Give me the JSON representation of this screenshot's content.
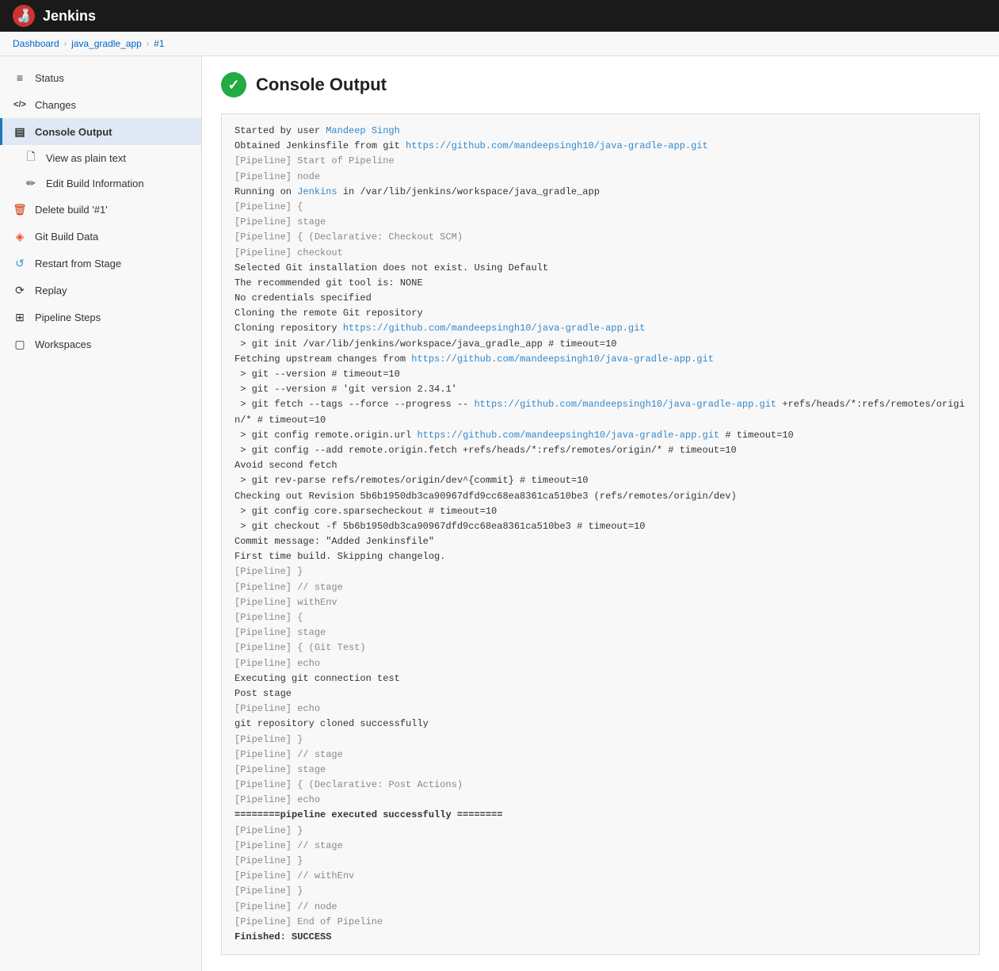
{
  "header": {
    "title": "Jenkins",
    "logo": "🍶"
  },
  "breadcrumb": {
    "items": [
      {
        "label": "Dashboard",
        "href": "#"
      },
      {
        "label": "java_gradle_app",
        "href": "#"
      },
      {
        "label": "#1",
        "href": "#"
      }
    ]
  },
  "sidebar": {
    "items": [
      {
        "id": "status",
        "label": "Status",
        "icon": "≡",
        "active": false
      },
      {
        "id": "changes",
        "label": "Changes",
        "icon": "</>",
        "active": false
      },
      {
        "id": "console-output",
        "label": "Console Output",
        "icon": "▤",
        "active": true
      },
      {
        "id": "view-plain-text",
        "label": "View as plain text",
        "icon": "🗋",
        "active": false,
        "sub": true
      },
      {
        "id": "edit-build-info",
        "label": "Edit Build Information",
        "icon": "✏",
        "active": false,
        "sub": true
      },
      {
        "id": "delete-build",
        "label": "Delete build '#1'",
        "icon": "🗑",
        "active": false
      },
      {
        "id": "git-build-data",
        "label": "Git Build Data",
        "icon": "◈",
        "active": false
      },
      {
        "id": "restart-from-stage",
        "label": "Restart from Stage",
        "icon": "↺",
        "active": false
      },
      {
        "id": "replay",
        "label": "Replay",
        "icon": "⟳",
        "active": false
      },
      {
        "id": "pipeline-steps",
        "label": "Pipeline Steps",
        "icon": "⊞",
        "active": false
      },
      {
        "id": "workspaces",
        "label": "Workspaces",
        "icon": "▢",
        "active": false
      }
    ]
  },
  "main": {
    "title": "Console Output",
    "content": {
      "started_by": "Started by user ",
      "user_link": "Mandeep Singh",
      "user_href": "#",
      "obtained_line": "Obtained Jenkinsfile from git ",
      "jenkinsfile_url": "https://github.com/mandeepsingh10/java-gradle-app.git",
      "lines_dim": [
        "[Pipeline] Start of Pipeline",
        "[Pipeline] node"
      ],
      "running_on_pre": "Running on ",
      "running_on_link": "Jenkins",
      "running_on_post": " in /var/lib/jenkins/workspace/java_gradle_app",
      "console_text": "[Pipeline] {\n[Pipeline] stage\n[Pipeline] { (Declarative: Checkout SCM)\n[Pipeline] checkout\nSelected Git installation does not exist. Using Default\nThe recommended git tool is: NONE\nNo credentials specified\nCloning the remote Git repository\nCloning repository https://github.com/mandeepsingh10/java-gradle-app.git\n > git init /var/lib/jenkins/workspace/java_gradle_app # timeout=10\nFetching upstream changes from https://github.com/mandeepsingh10/java-gradle-app.git\n > git --version # timeout=10\n > git --version # 'git version 2.34.1'\n > git fetch --tags --force --progress -- https://github.com/mandeepsingh10/java-gradle-app.git +refs/heads/*:refs/remotes/origin/* # timeout=10\n > git config remote.origin.url https://github.com/mandeepsingh10/java-gradle-app.git # timeout=10\n > git config --add remote.origin.fetch +refs/heads/*:refs/remotes/origin/* # timeout=10\nAvoid second fetch\n > git rev-parse refs/remotes/origin/dev^{commit} # timeout=10\nChecking out Revision 5b6b1950db3ca90967dfd9cc68ea8361ca510be3 (refs/remotes/origin/dev)\n > git config core.sparsecheckout # timeout=10\n > git checkout -f 5b6b1950db3ca90967dfd9cc68ea8361ca510be3 # timeout=10\nCommit message: \"Added Jenkinsfile\"\nFirst time build. Skipping changelog.\n[Pipeline] }\n[Pipeline] // stage\n[Pipeline] withEnv\n[Pipeline] {\n[Pipeline] stage\n[Pipeline] { (Git Test)\n[Pipeline] echo\nExecuting git connection test\nPost stage\n[Pipeline] echo\ngit repository cloned successfully\n[Pipeline] }\n[Pipeline] // stage\n[Pipeline] stage\n[Pipeline] { (Declarative: Post Actions)\n[Pipeline] echo\n========pipeline executed successfully ========\n[Pipeline] }\n[Pipeline] // stage\n[Pipeline] }\n[Pipeline] // withEnv\n[Pipeline] }\n[Pipeline] // node\n[Pipeline] End of Pipeline\nFinished: SUCCESS"
    }
  },
  "colors": {
    "accent_blue": "#2277bb",
    "link_blue": "#0066cc",
    "jenkins_link": "#3388cc",
    "header_bg": "#1a1a1a",
    "success_green": "#22aa44",
    "sidebar_active_bg": "#e0e8f5",
    "delete_red": "#cc3300"
  }
}
